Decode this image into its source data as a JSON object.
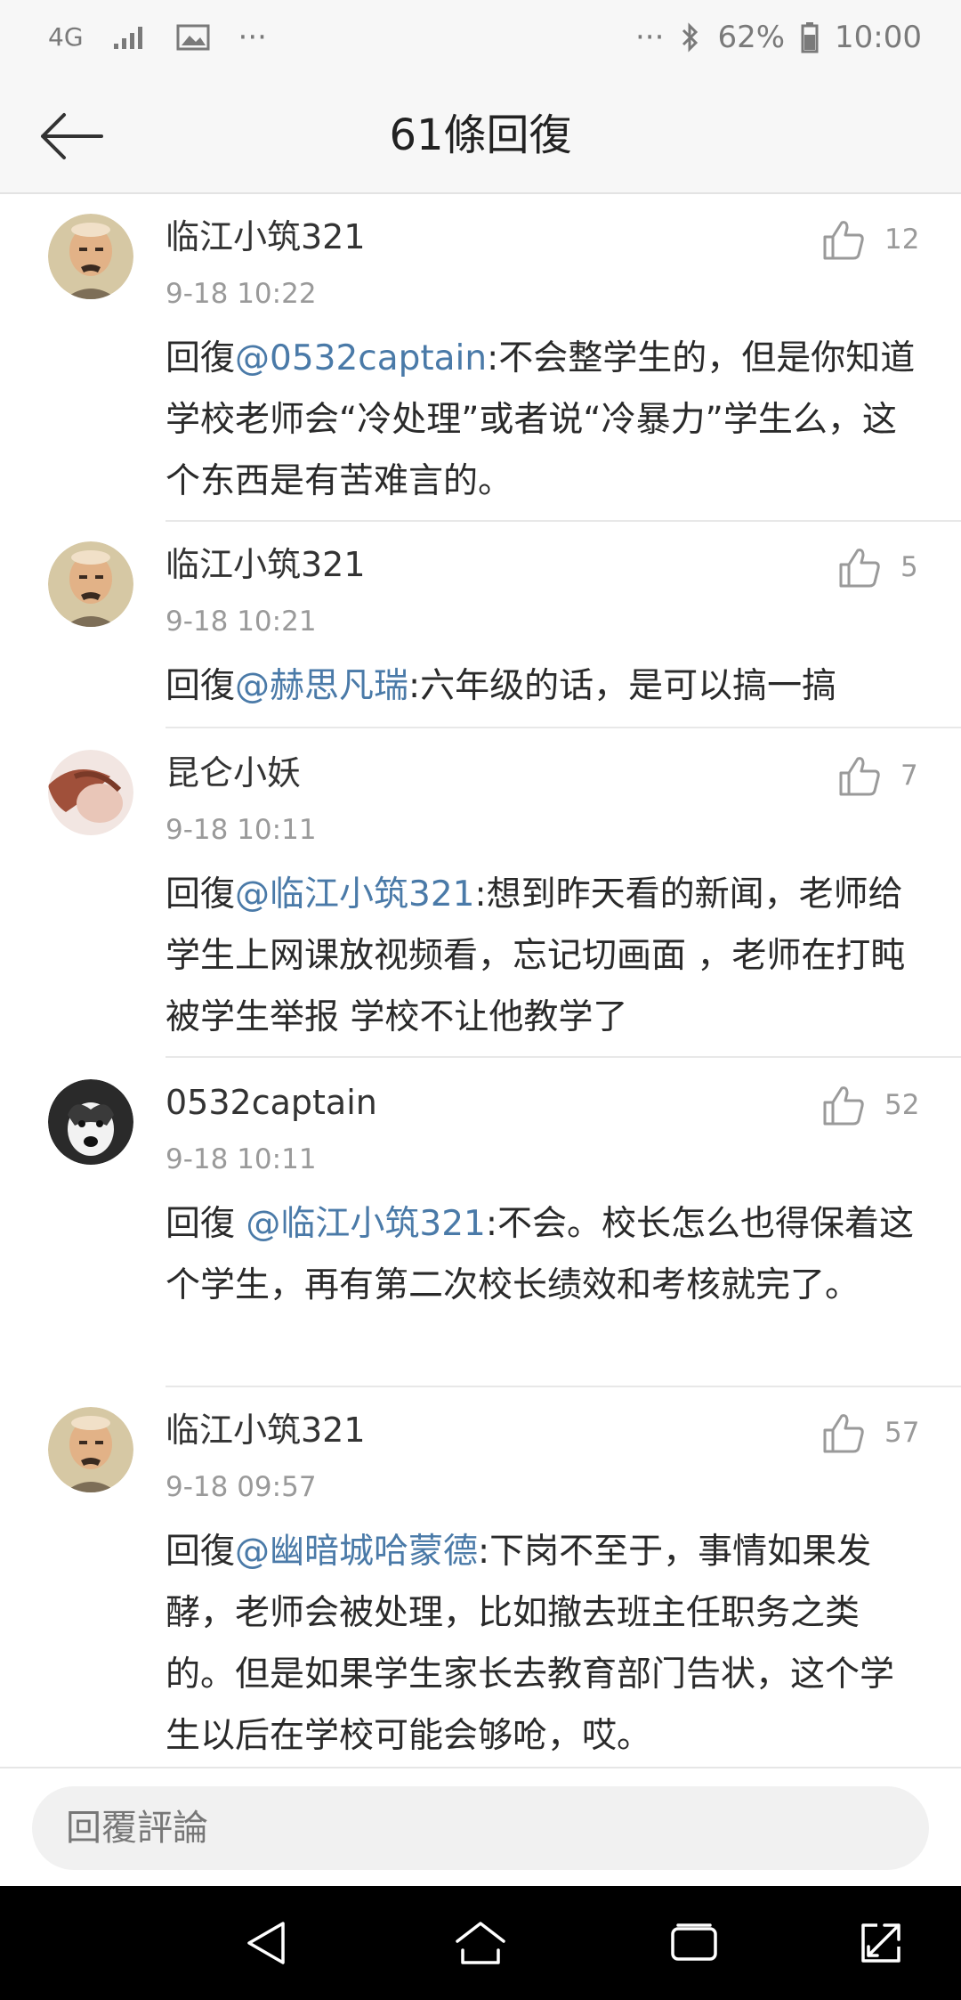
{
  "status_bar": {
    "network": "4G",
    "dots_left": "···",
    "dots_right": "···",
    "battery": "62%",
    "time": "10:00"
  },
  "header": {
    "title": "61條回復"
  },
  "comments": [
    {
      "name": "临江小筑321",
      "time": "9-18 10:22",
      "likes": "12",
      "prefix": "回復",
      "mention": "@0532captain",
      "text": ":不会整学生的，但是你知道学校老师会“冷处理”或者说“冷暴力”学生么，这个东西是有苦难言的。"
    },
    {
      "name": "临江小筑321",
      "time": "9-18 10:21",
      "likes": "5",
      "prefix": "回復",
      "mention": "@赫思凡瑞",
      "text": ":六年级的话，是可以搞一搞"
    },
    {
      "name": "昆仑小妖",
      "time": "9-18 10:11",
      "likes": "7",
      "prefix": "回復",
      "mention": "@临江小筑321",
      "text": ":想到昨天看的新闻，老师给学生上网课放视频看，忘记切画面 ，老师在打盹被学生举报 学校不让他教学了"
    },
    {
      "name": "0532captain",
      "time": "9-18 10:11",
      "likes": "52",
      "prefix": "回復 ",
      "mention": "@临江小筑321",
      "text": ":不会。校长怎么也得保着这个学生，再有第二次校长绩效和考核就完了。"
    },
    {
      "name": "临江小筑321",
      "time": "9-18 09:57",
      "likes": "57",
      "prefix": "回復",
      "mention": "@幽暗城哈蒙德",
      "text": ":下岗不至于，事情如果发酵，老师会被处理，比如撤去班主任职务之类的。但是如果学生家长去教育部门告状，这个学生以后在学校可能会够呛，哎。"
    }
  ],
  "reply_input": {
    "placeholder": "回覆評論"
  },
  "colors": {
    "mention": "#4a7aa8",
    "meta": "#9a9a9a",
    "header_bg": "#f7f7f7",
    "navbar_bg": "#000000"
  }
}
